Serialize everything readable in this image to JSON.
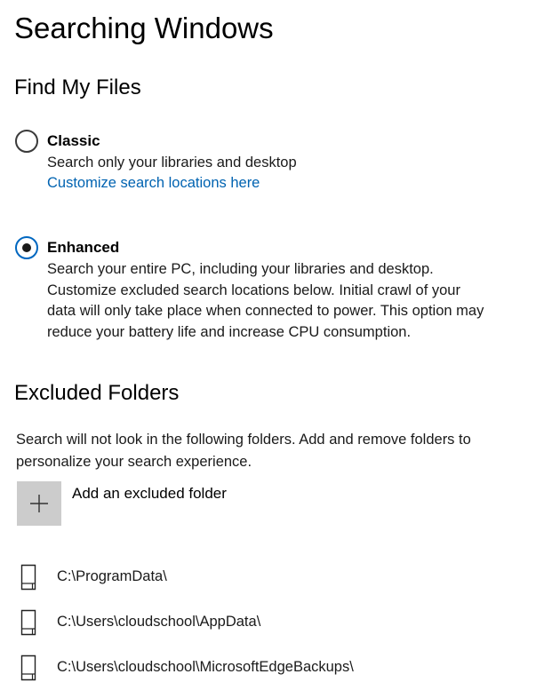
{
  "page": {
    "title": "Searching Windows"
  },
  "find_my_files": {
    "heading": "Find My Files",
    "options": [
      {
        "label": "Classic",
        "selected": false,
        "description_lines": [
          "Search only your libraries and desktop"
        ],
        "link": "Customize search locations here"
      },
      {
        "label": "Enhanced",
        "selected": true,
        "description_lines": [
          "Search your entire PC, including your libraries and desktop.",
          "Customize excluded search locations below. Initial crawl of your",
          "data will only take place when connected to power. This option may",
          "reduce your battery life and increase CPU consumption."
        ]
      }
    ]
  },
  "excluded_folders": {
    "heading": "Excluded Folders",
    "description_lines": [
      "Search will not look in the following folders. Add and remove folders to",
      "personalize your search experience."
    ],
    "add_button": {
      "label": "Add an excluded folder",
      "icon": "plus-icon"
    },
    "folders": [
      {
        "path": "C:\\ProgramData\\",
        "icon": "folder-icon"
      },
      {
        "path": "C:\\Users\\cloudschool\\AppData\\",
        "icon": "folder-icon"
      },
      {
        "path": "C:\\Users\\cloudschool\\MicrosoftEdgeBackups\\",
        "icon": "folder-icon"
      }
    ]
  },
  "colors": {
    "accent": "#0067c0",
    "link": "#0063b1",
    "tile": "#cccccc"
  }
}
